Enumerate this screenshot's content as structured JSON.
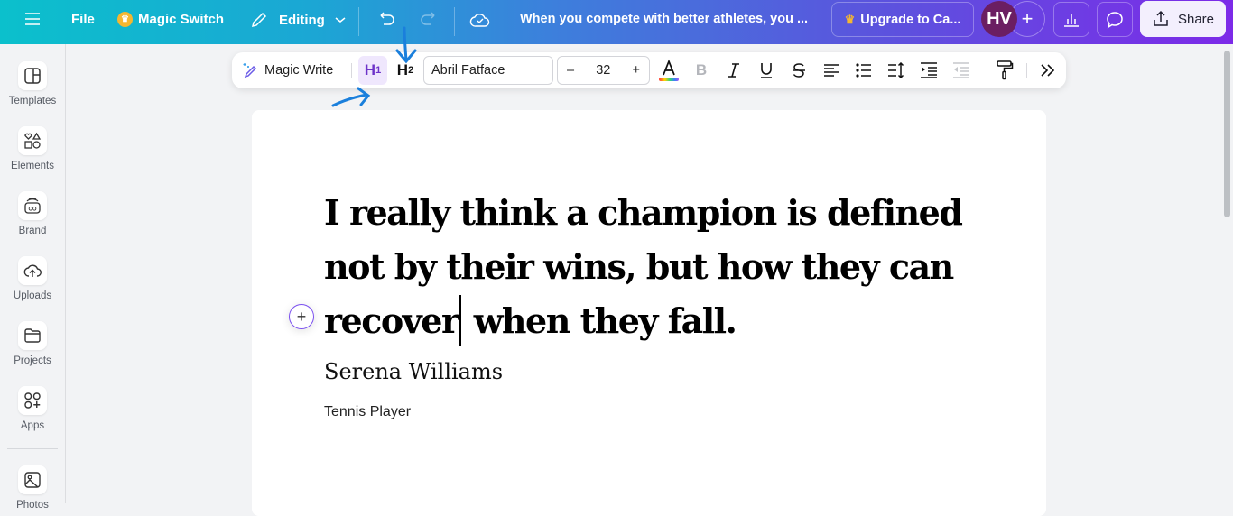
{
  "topbar": {
    "menu_icon": "hamburger-icon",
    "file_label": "File",
    "magic_switch_label": "Magic Switch",
    "editing_label": "Editing",
    "document_title": "When you compete with better athletes, you ...",
    "upgrade_label": "Upgrade to Ca...",
    "avatar_initials": "HV",
    "share_label": "Share",
    "accent_colors": {
      "start": "#0bc0cc",
      "end": "#7c2ae8",
      "avatar": "#6b1e62"
    }
  },
  "sidebar": {
    "items": [
      {
        "label": "Templates",
        "icon": "templates-icon"
      },
      {
        "label": "Elements",
        "icon": "elements-icon"
      },
      {
        "label": "Brand",
        "icon": "brand-icon"
      },
      {
        "label": "Uploads",
        "icon": "uploads-icon"
      },
      {
        "label": "Projects",
        "icon": "projects-icon"
      },
      {
        "label": "Apps",
        "icon": "apps-icon"
      },
      {
        "label": "Photos",
        "icon": "photos-icon"
      }
    ]
  },
  "toolbar": {
    "magic_write_label": "Magic Write",
    "h1_label": "H",
    "h1_sub": "1",
    "h2_label": "H",
    "h2_sub": "2",
    "font_name": "Abril Fatface",
    "font_size": "32",
    "decrease_label": "–",
    "increase_label": "+"
  },
  "canvas": {
    "quote_part1": "I really think a champion is defined not by their wins, but how they can recover",
    "quote_part2": " when they fall.",
    "author": "Serena Williams",
    "role": "Tennis Player"
  }
}
